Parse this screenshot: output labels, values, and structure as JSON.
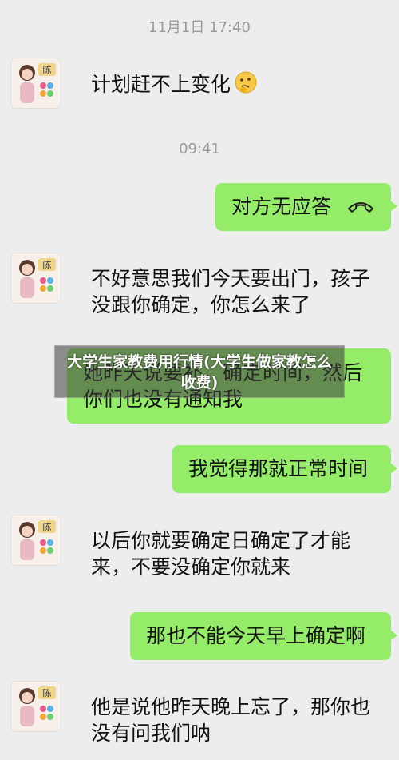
{
  "timestamps": [
    "11月1日 17:40",
    "09:41"
  ],
  "messages": {
    "m1": "计划赶不上变化",
    "m2": "对方无应答",
    "m3": "不好意思我们今天要出门，孩子没跟你确定，你怎么来了",
    "m4": "她昨天说要补，确定时间，然后你们也没有通知我",
    "m5": "我觉得那就正常时间",
    "m6": "以后你就要确定日确定了才能来，不要没确定你就来",
    "m7": "那也不能今天早上确定啊",
    "m8": "他是说他昨天晚上忘了，那你也没有问我们呐"
  },
  "avatar": {
    "badge": "陈"
  },
  "overlay": {
    "title": "大学生家教费用行情(大学生做家教怎么收费)"
  },
  "colors": {
    "background": "#ededed",
    "green_bubble": "#95ec69",
    "white_bubble": "#ffffff",
    "timestamp": "#9a9a9a"
  },
  "icons": [
    "thinking-emoji",
    "call-ended-icon"
  ]
}
